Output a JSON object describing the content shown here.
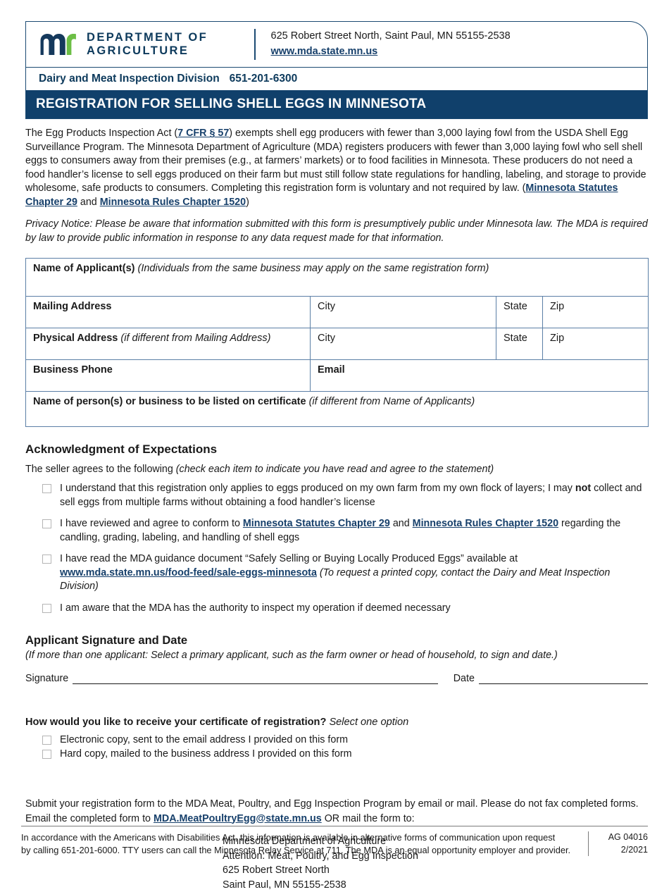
{
  "header": {
    "logo_line1": "DEPARTMENT OF",
    "logo_line2": "AGRICULTURE",
    "address": "625 Robert Street North, Saint Paul, MN 55155-2538",
    "website": "www.mda.state.mn.us",
    "division": "Dairy and Meat Inspection Division",
    "phone": "651-201-6300",
    "title": "REGISTRATION FOR SELLING SHELL EGGS IN MINNESOTA",
    "colors": {
      "navy": "#10406b",
      "border": "#1b4a72",
      "green": "#6cbe45",
      "link": "#17406b"
    }
  },
  "intro": {
    "p1_a": "The Egg Products Inspection Act (",
    "p1_link1": "7 CFR § 57",
    "p1_b": ") exempts shell egg producers with fewer than 3,000 laying fowl from the USDA Shell Egg Surveillance Program. The Minnesota Department of Agriculture (MDA) registers producers with fewer than 3,000 laying fowl who sell shell eggs to consumers away from their premises (e.g., at farmers’ markets) or to food facilities in Minnesota. These producers do not need a food handler’s license to sell eggs produced on their farm but must still follow state regulations for handling, labeling, and storage to provide wholesome, safe products to consumers. Completing this registration form is voluntary and not required by law. (",
    "p1_link2": "Minnesota Statutes Chapter 29",
    "p1_c": " and ",
    "p1_link3": "Minnesota Rules Chapter 1520",
    "p1_d": ")",
    "privacy": "Privacy Notice: Please be aware that information submitted with this form is presumptively public under Minnesota law. The MDA is required by law to provide public information in response to any data request made for that information."
  },
  "form": {
    "name_label": "Name of Applicant(s)",
    "name_hint": "(Individuals from the same business may apply on the same registration form)",
    "mailing_label": "Mailing Address",
    "city_label": "City",
    "state_label": "State",
    "zip_label": "Zip",
    "physical_label": "Physical Address",
    "physical_hint": "(if different from Mailing Address)",
    "phone_label": "Business Phone",
    "email_label": "Email",
    "cert_label": "Name of person(s) or business to be listed on certificate",
    "cert_hint": "(if different from Name of Applicants)",
    "values": {
      "applicant_name": "",
      "mailing_address": "",
      "mailing_city": "",
      "mailing_state": "",
      "mailing_zip": "",
      "physical_address": "",
      "physical_city": "",
      "physical_state": "",
      "physical_zip": "",
      "business_phone": "",
      "email": "",
      "certificate_name": ""
    }
  },
  "acknowledgment": {
    "heading": "Acknowledgment of Expectations",
    "subtitle_a": "The seller agrees to the following ",
    "subtitle_i": "(check each item to indicate you have read and agree to the statement)",
    "items": [
      {
        "checked": false,
        "text_a": "I understand that this registration only applies to eggs produced on my own farm from my own flock of layers; I may ",
        "bold": "not",
        "text_b": " collect and sell eggs from multiple farms without obtaining a food handler’s license"
      },
      {
        "checked": false,
        "text_a": "I have reviewed and agree to conform to ",
        "link1": "Minnesota Statutes Chapter 29",
        "text_b": " and ",
        "link2": "Minnesota Rules Chapter 1520",
        "text_c": " regarding the candling, grading, labeling, and handling of shell eggs"
      },
      {
        "checked": false,
        "text_a": "I have read the MDA guidance document “Safely Selling or Buying Locally Produced Eggs” available at ",
        "link1": "www.mda.state.mn.us/food-feed/sale-eggs-minnesota",
        "italic": " (To request a printed copy, contact the Dairy and Meat Inspection Division)"
      },
      {
        "checked": false,
        "text_a": "I am aware that the MDA has the authority to inspect my operation if deemed necessary"
      }
    ]
  },
  "signature": {
    "heading": "Applicant Signature and Date",
    "note": "(If more than one applicant: Select a primary applicant, such as the farm owner or head of household, to sign and date.)",
    "signature_label": "Signature",
    "signature_value": "",
    "date_label": "Date",
    "date_value": ""
  },
  "delivery": {
    "question": "How would you like to receive your certificate of registration?",
    "question_hint": "Select one option",
    "options": [
      {
        "checked": false,
        "label": "Electronic copy, sent to the email address I provided on this form"
      },
      {
        "checked": false,
        "label": "Hard copy, mailed to the business address I provided on this form"
      }
    ]
  },
  "submit": {
    "line1": "Submit your registration form to the MDA Meat, Poultry, and Egg Inspection Program by email or mail. Please do not fax completed forms.",
    "line2_a": "Email the completed form to ",
    "email_link": "MDA.MeatPoultryEgg@state.mn.us",
    "line2_b": " OR mail the form to:",
    "address_lines": [
      "Minnesota Department of Agriculture",
      "Attention: Meat, Poultry, and Egg Inspection",
      "625 Robert Street North",
      "Saint Paul, MN 55155-2538"
    ]
  },
  "footer": {
    "text_line1": "In accordance with the Americans with Disabilities Act, this information is available in alternative forms of communication upon request",
    "text_line2": "by calling 651-201-6000. TTY users can call the Minnesota Relay Service at 711. The MDA is an equal opportunity employer and provider.",
    "form_number": "AG 04016",
    "form_date": "2/2021"
  }
}
